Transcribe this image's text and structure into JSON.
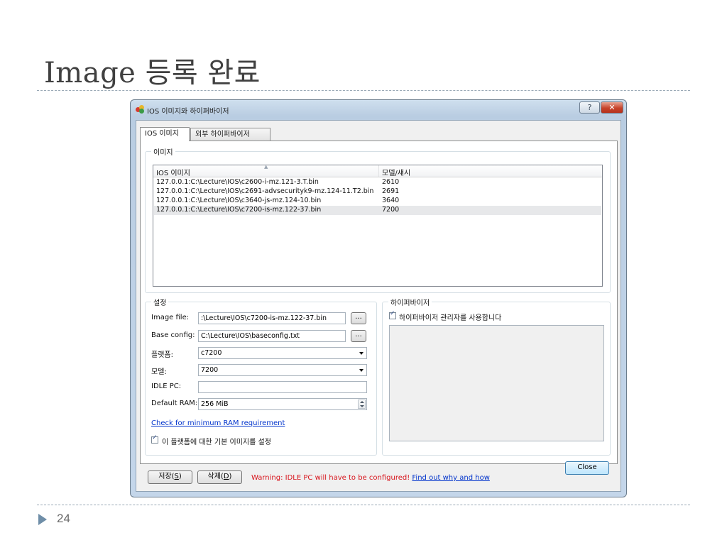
{
  "slide": {
    "title": "Image 등록 완료",
    "page_number": "24"
  },
  "window": {
    "title": "IOS 이미지와 하이퍼바이저",
    "help_label": "?",
    "close_label": "✕"
  },
  "tabs": [
    {
      "label": "IOS 이미지",
      "active": true
    },
    {
      "label": "외부 하이퍼바이저",
      "active": false
    }
  ],
  "images_group": {
    "label": "이미지",
    "columns": [
      "IOS 이미지",
      "모델/섀시"
    ],
    "rows": [
      {
        "image": "127.0.0.1:C:\\Lecture\\IOS\\c2600-i-mz.121-3.T.bin",
        "model": "2610"
      },
      {
        "image": "127.0.0.1:C:\\Lecture\\IOS\\c2691-advsecurityk9-mz.124-11.T2.bin",
        "model": "2691"
      },
      {
        "image": "127.0.0.1:C:\\Lecture\\IOS\\c3640-js-mz.124-10.bin",
        "model": "3640"
      },
      {
        "image": "127.0.0.1:C:\\Lecture\\IOS\\c7200-is-mz.122-37.bin",
        "model": "7200"
      }
    ]
  },
  "settings": {
    "label": "설정",
    "image_file_label": "Image file:",
    "image_file_value": ":\\Lecture\\IOS\\c7200-is-mz.122-37.bin",
    "base_config_label": "Base config:",
    "base_config_value": "C:\\Lecture\\IOS\\baseconfig.txt",
    "browse_label": "...",
    "platform_label": "플랫폼:",
    "platform_value": "c7200",
    "model_label": "모델:",
    "model_value": "7200",
    "idle_pc_label": "IDLE PC:",
    "idle_pc_value": "",
    "default_ram_label": "Default RAM:",
    "default_ram_value": "256 MiB",
    "check_ram_link": "Check for minimum RAM requirement",
    "default_image_checkbox_label": "이 플랫폼에 대한 기본 이미지를 설정",
    "default_image_checked": true
  },
  "hypervisor": {
    "label": "하이퍼바이저",
    "use_manager_label": "하이퍼바이저 관리자를 사용합니다",
    "use_manager_checked": true
  },
  "footer": {
    "save_label": "저장(",
    "save_key": "S",
    "delete_label": "삭제(",
    "delete_key": "D",
    "paren_close": ")",
    "warning_text": "Warning: IDLE PC will have to be configured! ",
    "warning_link": "Find out why and how",
    "close_label": "Close"
  },
  "colors": {
    "warning": "#d8141c",
    "link": "#0033cc",
    "title": "#404040"
  }
}
